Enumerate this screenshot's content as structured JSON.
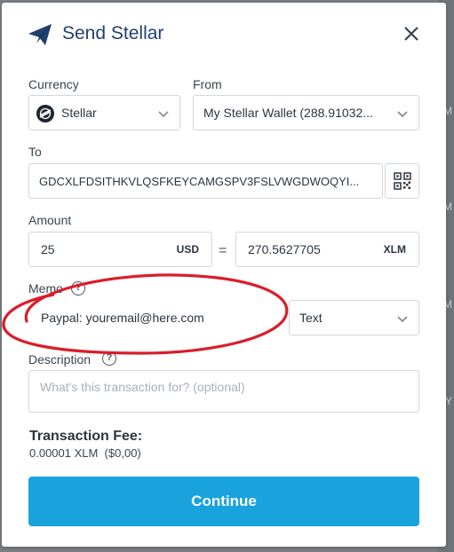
{
  "dialog": {
    "title": "Send Stellar",
    "close_glyph": "✕"
  },
  "currency": {
    "label": "Currency",
    "value": "Stellar",
    "icon": "stellar-logo-icon"
  },
  "from": {
    "label": "From",
    "value": "My Stellar Wallet (288.91032..."
  },
  "to": {
    "label": "To",
    "value": "GDCXLFDSITHKVLQSFKEYCAMGSPV3FSLVWGDWOQYI..."
  },
  "amount": {
    "label": "Amount",
    "fiat_value": "25",
    "fiat_unit": "USD",
    "equals": "=",
    "crypto_value": "270.5627705",
    "crypto_unit": "XLM"
  },
  "memo": {
    "label": "Memo",
    "value": "Paypal: youremail@here.com",
    "type": "Text",
    "help_glyph": "?"
  },
  "description": {
    "label": "Description",
    "placeholder": "What's this transaction for? (optional)",
    "help_glyph": "?"
  },
  "fee": {
    "title": "Transaction Fee:",
    "value": "0.00001 XLM  ($0,00)"
  },
  "continue_label": "Continue",
  "background_letters": [
    "M",
    "M",
    "M",
    "Y"
  ],
  "colors": {
    "accent": "#19a3dd",
    "title": "#1f4070",
    "annotation": "#d91e2a"
  }
}
